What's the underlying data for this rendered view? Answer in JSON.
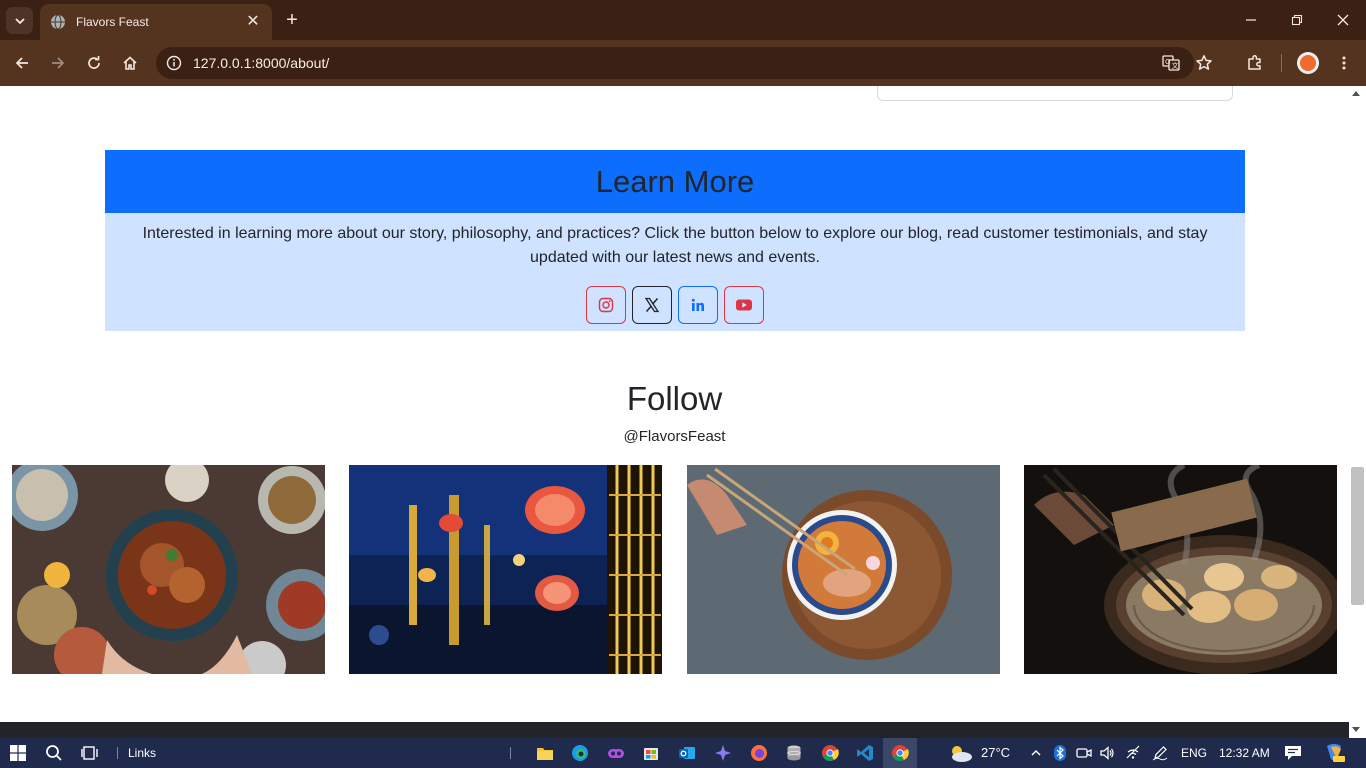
{
  "browser": {
    "tab_title": "Flavors Feast",
    "url": "127.0.0.1:8000/about/"
  },
  "learn_more": {
    "heading": "Learn More",
    "body": "Interested in learning more about our story, philosophy, and practices? Click the button below to explore our blog, read customer testimonials, and stay updated with our latest news and events.",
    "social": [
      {
        "name": "instagram",
        "icon": "instagram-icon",
        "color": "#dc3545"
      },
      {
        "name": "x",
        "icon": "x-icon",
        "color": "#212529"
      },
      {
        "name": "linkedin",
        "icon": "linkedin-icon",
        "color": "#0d6efd"
      },
      {
        "name": "youtube",
        "icon": "youtube-icon",
        "color": "#dc3545"
      }
    ]
  },
  "follow": {
    "heading": "Follow",
    "handle": "@FlavorsFeast",
    "photos": [
      "noodle-bowl-photo",
      "lanterns-photo",
      "ramen-photo",
      "dumplings-photo"
    ]
  },
  "taskbar": {
    "links_label": "Links",
    "temperature": "27°C",
    "language": "ENG",
    "time": "12:32 AM"
  },
  "colors": {
    "primary": "#0d6efd",
    "primary_subtle": "#cfe2ff",
    "chrome_dark": "#3b2113",
    "chrome_toolbar": "#54341f"
  }
}
